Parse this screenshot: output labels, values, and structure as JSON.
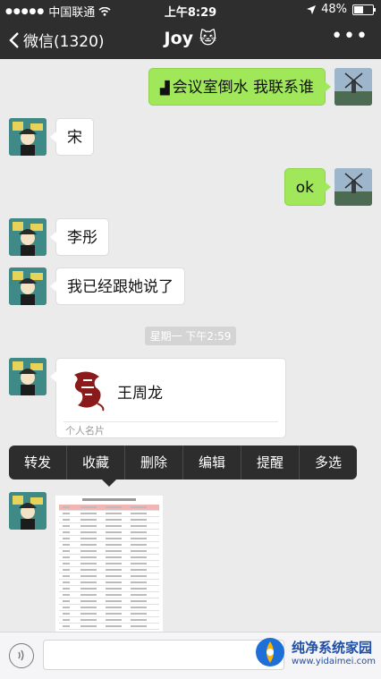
{
  "status_bar": {
    "carrier": "中国联通",
    "time": "上午8:29",
    "battery_text": "48%",
    "battery_level": 0.48
  },
  "nav": {
    "back_label": "微信(1320)",
    "title": "Joy 🐱",
    "more_icon": "more-dots-icon"
  },
  "messages": [
    {
      "side": "self",
      "text": "会议室倒水 我联系谁"
    },
    {
      "side": "other",
      "text": "宋"
    },
    {
      "side": "self",
      "text": "ok"
    },
    {
      "side": "other",
      "text": "李彤"
    },
    {
      "side": "other",
      "text": "我已经跟她说了"
    }
  ],
  "time_divider": "星期一 下午2:59",
  "contact_card": {
    "name": "王周龙",
    "caption": "个人名片",
    "logo_color": "#8b1a1a"
  },
  "context_menu": [
    "转发",
    "收藏",
    "删除",
    "编辑",
    "提醒",
    "多选"
  ],
  "input": {
    "placeholder": ""
  },
  "watermark": {
    "title": "纯净系统家园",
    "subtitle": "www.yidaimei.com"
  },
  "colors": {
    "nav_bg": "#2e2e2e",
    "self_bubble": "#a0e75a",
    "chat_bg": "#ebebeb"
  }
}
